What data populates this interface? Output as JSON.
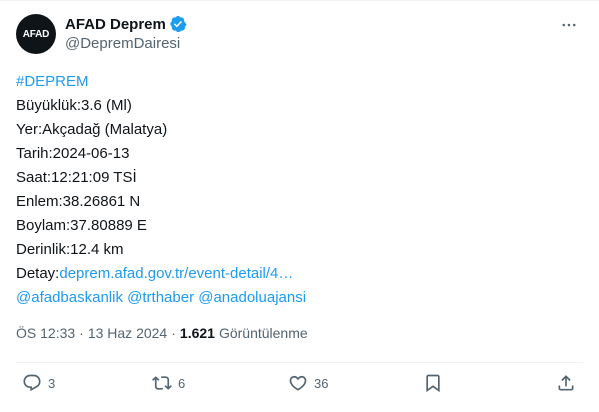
{
  "header": {
    "avatar_text": "AFAD",
    "display_name": "AFAD Deprem",
    "handle": "@DepremDairesi",
    "icons": {
      "verified": "verified-badge-icon",
      "more": "more-options-icon"
    },
    "verified_color": "#1d9bf0"
  },
  "post": {
    "hashtag": "#DEPREM",
    "lines": [
      "Büyüklük:3.6 (Ml)",
      "Yer:Akçadağ (Malatya)",
      "Tarih:2024-06-13",
      "Saat:12:21:09 TSİ",
      "Enlem:38.26861 N",
      "Boylam:37.80889 E",
      "Derinlik:12.4 km"
    ],
    "detail_label": "Detay:",
    "detail_link": "deprem.afad.gov.tr/event-detail/4…",
    "mentions": [
      "@afadbaskanlik",
      "@trthaber",
      "@anadoluajansi"
    ]
  },
  "meta": {
    "time": "ÖS 12:33",
    "date": "13 Haz 2024",
    "views_count": "1.621",
    "views_label": "Görüntülenme"
  },
  "actions": {
    "reply_count": "3",
    "repost_count": "6",
    "like_count": "36",
    "icons": [
      "reply-icon",
      "repost-icon",
      "like-icon",
      "bookmark-icon",
      "share-icon"
    ]
  },
  "colors": {
    "link": "#1d9bf0",
    "text": "#0f1419",
    "secondary": "#536471"
  }
}
